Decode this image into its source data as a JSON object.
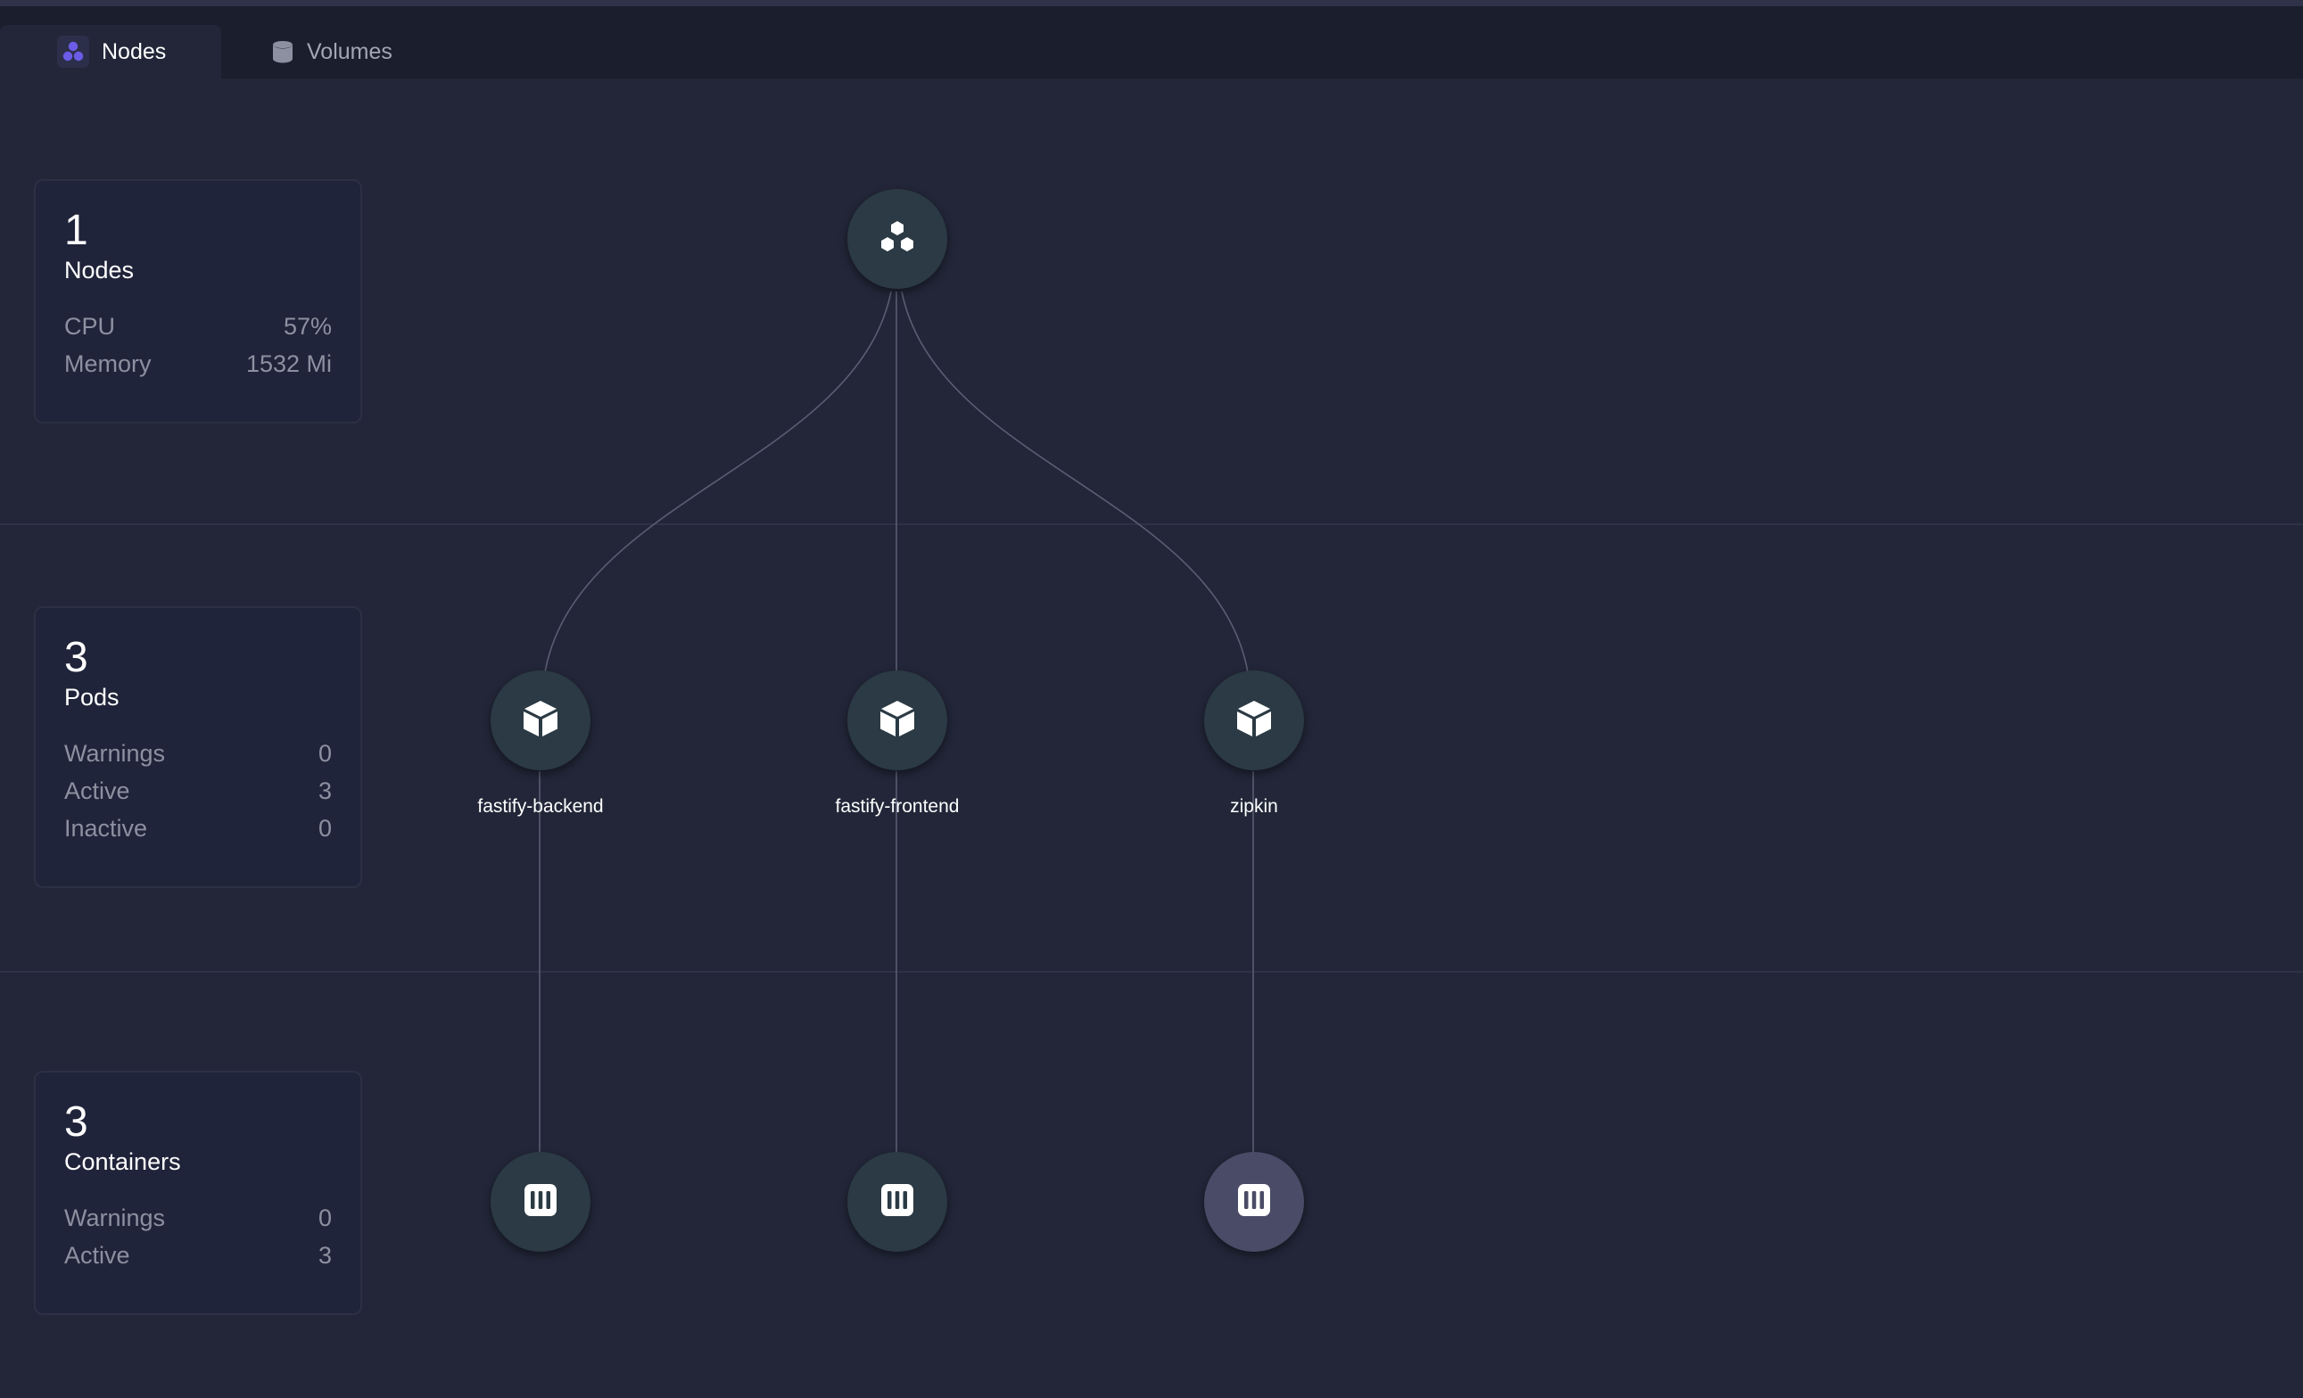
{
  "tabs": [
    {
      "label": "Nodes",
      "icon": "cluster-icon",
      "active": true
    },
    {
      "label": "Volumes",
      "icon": "database-icon",
      "active": false
    }
  ],
  "summary": {
    "nodes": {
      "count": "1",
      "title": "Nodes",
      "stats": [
        {
          "label": "CPU",
          "value": "57%"
        },
        {
          "label": "Memory",
          "value": "1532 Mi"
        }
      ]
    },
    "pods": {
      "count": "3",
      "title": "Pods",
      "stats": [
        {
          "label": "Warnings",
          "value": "0"
        },
        {
          "label": "Active",
          "value": "3"
        },
        {
          "label": "Inactive",
          "value": "0"
        }
      ]
    },
    "containers": {
      "count": "3",
      "title": "Containers",
      "stats": [
        {
          "label": "Warnings",
          "value": "0"
        },
        {
          "label": "Active",
          "value": "3"
        }
      ]
    }
  },
  "graph": {
    "cluster_node": {
      "icon": "cluster-icon"
    },
    "pods": [
      {
        "name": "fastify-backend",
        "icon": "cube-icon"
      },
      {
        "name": "fastify-frontend",
        "icon": "cube-icon"
      },
      {
        "name": "zipkin",
        "icon": "cube-icon"
      }
    ],
    "containers": [
      {
        "icon": "container-icon",
        "highlighted": false
      },
      {
        "icon": "container-icon",
        "highlighted": false
      },
      {
        "icon": "container-icon",
        "highlighted": true
      }
    ]
  },
  "colors": {
    "background": "#222638",
    "tabbar": "#1b1e2c",
    "node_fill": "#2b3a44",
    "node_highlight": "#4a4b66",
    "accent": "#6b5ce7"
  }
}
